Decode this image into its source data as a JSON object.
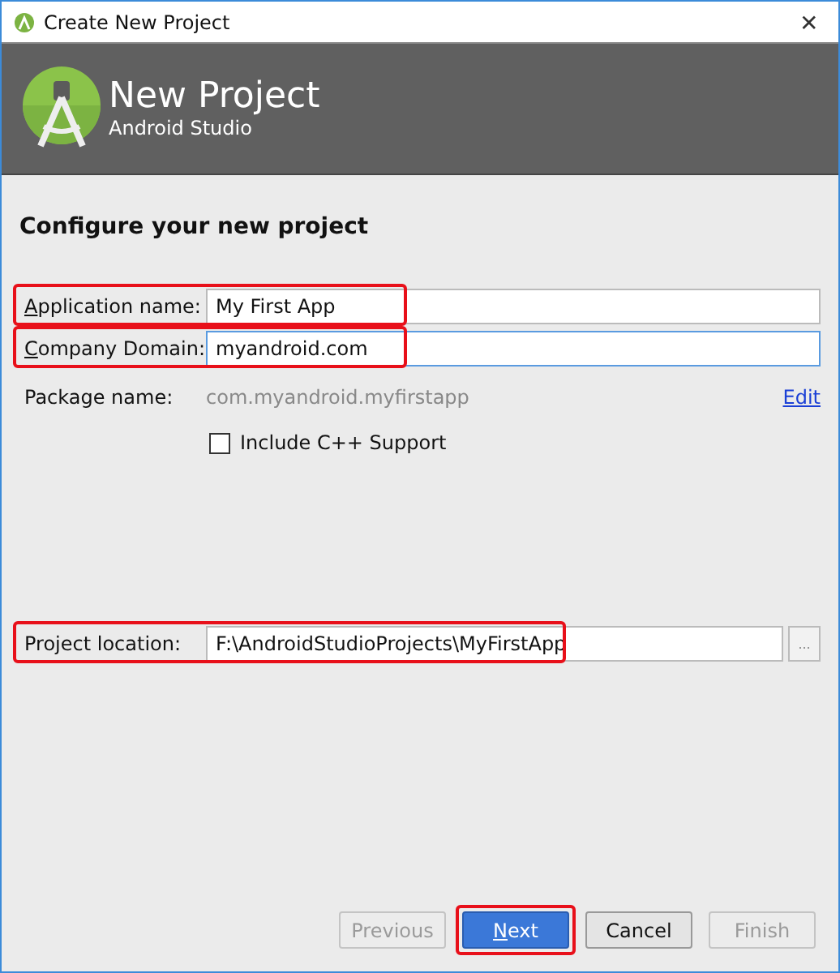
{
  "window": {
    "title": "Create New Project",
    "close": "✕"
  },
  "header": {
    "title": "New Project",
    "subtitle": "Android Studio"
  },
  "section_title": "Configure your new project",
  "fields": [
    {
      "label": "Application name:",
      "value": "My First App",
      "mnemonic": true,
      "highlighted": true,
      "focused": false
    },
    {
      "label": "Company Domain:",
      "value": "myandroid.com",
      "mnemonic": true,
      "highlighted": true,
      "focused": true
    }
  ],
  "package": {
    "label": "Package name:",
    "value": "com.myandroid.myfirstapp",
    "link": "Edit"
  },
  "checkbox": {
    "label": "Include C++ Support",
    "checked": false
  },
  "location": {
    "label": "Project location:",
    "value": "F:\\AndroidStudioProjects\\MyFirstApp",
    "highlighted": true,
    "browse": "..."
  },
  "buttons": [
    {
      "label": "Previous",
      "disabled": true,
      "primary": false,
      "mnemonic": false,
      "highlighted": false
    },
    {
      "label": "Next",
      "disabled": false,
      "primary": true,
      "mnemonic": true,
      "highlighted": true
    },
    {
      "label": "Cancel",
      "disabled": false,
      "primary": false,
      "mnemonic": false,
      "highlighted": false
    },
    {
      "label": "Finish",
      "disabled": true,
      "primary": false,
      "mnemonic": false,
      "highlighted": false
    }
  ]
}
